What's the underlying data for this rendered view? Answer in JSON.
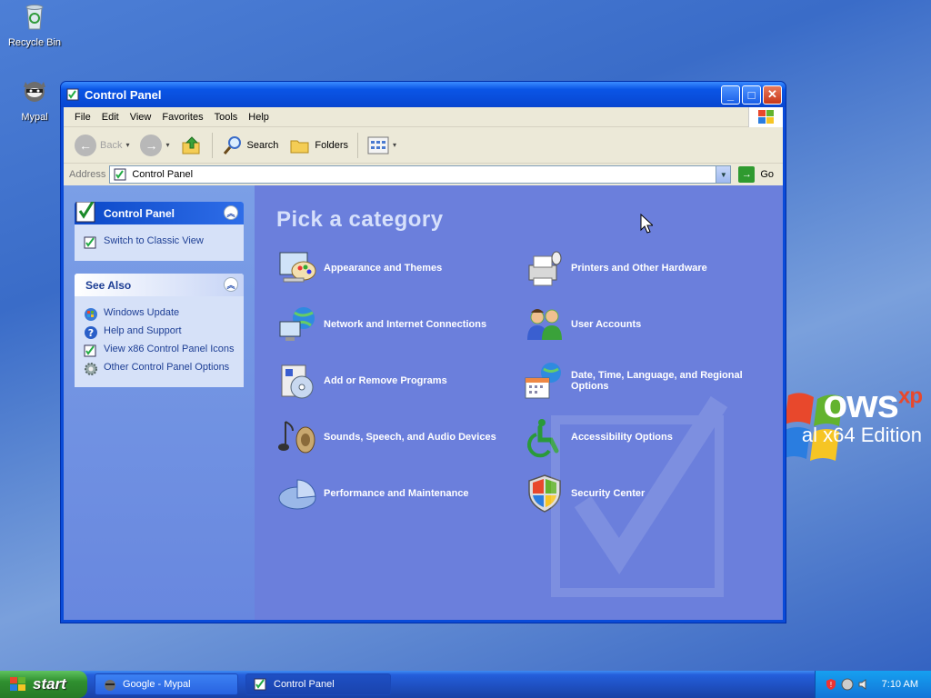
{
  "desktop": {
    "icons": [
      {
        "label": "Recycle Bin"
      },
      {
        "label": "Mypal"
      }
    ],
    "brand_text": "ows",
    "brand_sup": "xp",
    "edition": "al x64 Edition"
  },
  "window": {
    "title": "Control Panel",
    "menu": [
      "File",
      "Edit",
      "View",
      "Favorites",
      "Tools",
      "Help"
    ],
    "toolbar": {
      "back": "Back",
      "search": "Search",
      "folders": "Folders"
    },
    "address": {
      "label": "Address",
      "value": "Control Panel",
      "go": "Go"
    },
    "taskpane": {
      "control_panel": {
        "title": "Control Panel",
        "items": [
          "Switch to Classic View"
        ]
      },
      "see_also": {
        "title": "See Also",
        "items": [
          "Windows Update",
          "Help and Support",
          "View x86 Control Panel Icons",
          "Other Control Panel Options"
        ]
      }
    },
    "main": {
      "heading": "Pick a category",
      "categories": [
        {
          "label": "Appearance and Themes",
          "icon": "appearance-icon"
        },
        {
          "label": "Printers and Other Hardware",
          "icon": "printer-icon"
        },
        {
          "label": "Network and Internet Connections",
          "icon": "network-icon"
        },
        {
          "label": "User Accounts",
          "icon": "users-icon"
        },
        {
          "label": "Add or Remove Programs",
          "icon": "programs-icon"
        },
        {
          "label": "Date, Time, Language, and Regional Options",
          "icon": "datetime-icon"
        },
        {
          "label": "Sounds, Speech, and Audio Devices",
          "icon": "sound-icon"
        },
        {
          "label": "Accessibility Options",
          "icon": "accessibility-icon"
        },
        {
          "label": "Performance and Maintenance",
          "icon": "performance-icon"
        },
        {
          "label": "Security Center",
          "icon": "shield-icon"
        }
      ]
    }
  },
  "taskbar": {
    "start": "start",
    "items": [
      "Google - Mypal",
      "Control Panel"
    ],
    "clock": "7:10 AM"
  }
}
